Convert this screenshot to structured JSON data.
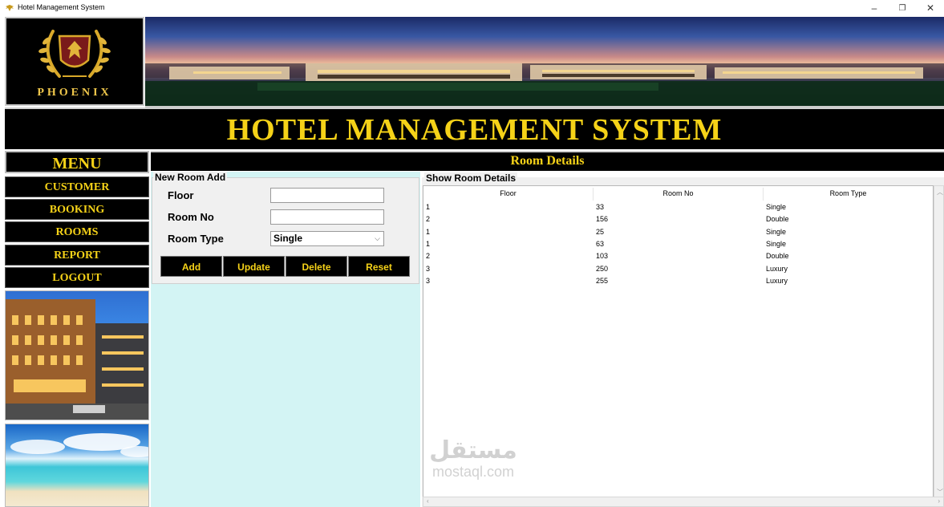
{
  "window": {
    "title": "Hotel Management System",
    "minimize": "–",
    "restore": "❐",
    "close": "✕"
  },
  "logo": {
    "text": "PHOENIX"
  },
  "header": {
    "title": "HOTEL MANAGEMENT SYSTEM"
  },
  "menu": {
    "title": "MENU",
    "items": [
      "CUSTOMER",
      "BOOKING",
      "ROOMS",
      "REPORT",
      "LOGOUT"
    ]
  },
  "section": {
    "title": "Room Details"
  },
  "form": {
    "group_title": "New Room Add",
    "floor_label": "Floor",
    "floor_value": "",
    "room_no_label": "Room No",
    "room_no_value": "",
    "room_type_label": "Room Type",
    "room_type_value": "Single",
    "buttons": {
      "add": "Add",
      "update": "Update",
      "delete": "Delete",
      "reset": "Reset"
    }
  },
  "grid": {
    "group_title": "Show Room Details",
    "columns": [
      "Floor",
      "Room No",
      "Room Type"
    ],
    "rows": [
      [
        "1",
        "33",
        "Single"
      ],
      [
        "2",
        "156",
        "Double"
      ],
      [
        "1",
        "25",
        "Single"
      ],
      [
        "1",
        "63",
        "Single"
      ],
      [
        "2",
        "103",
        "Double"
      ],
      [
        "3",
        "250",
        "Luxury"
      ],
      [
        "3",
        "255",
        "Luxury"
      ]
    ]
  },
  "watermark": {
    "arabic": "مستقل",
    "latin": "mostaql.com"
  },
  "colors": {
    "accent_gold": "#f5d218",
    "panel_black": "#000000",
    "form_bg": "#d3f4f4"
  },
  "icons": [
    "phoenix-app-icon",
    "chevron-down-icon"
  ]
}
